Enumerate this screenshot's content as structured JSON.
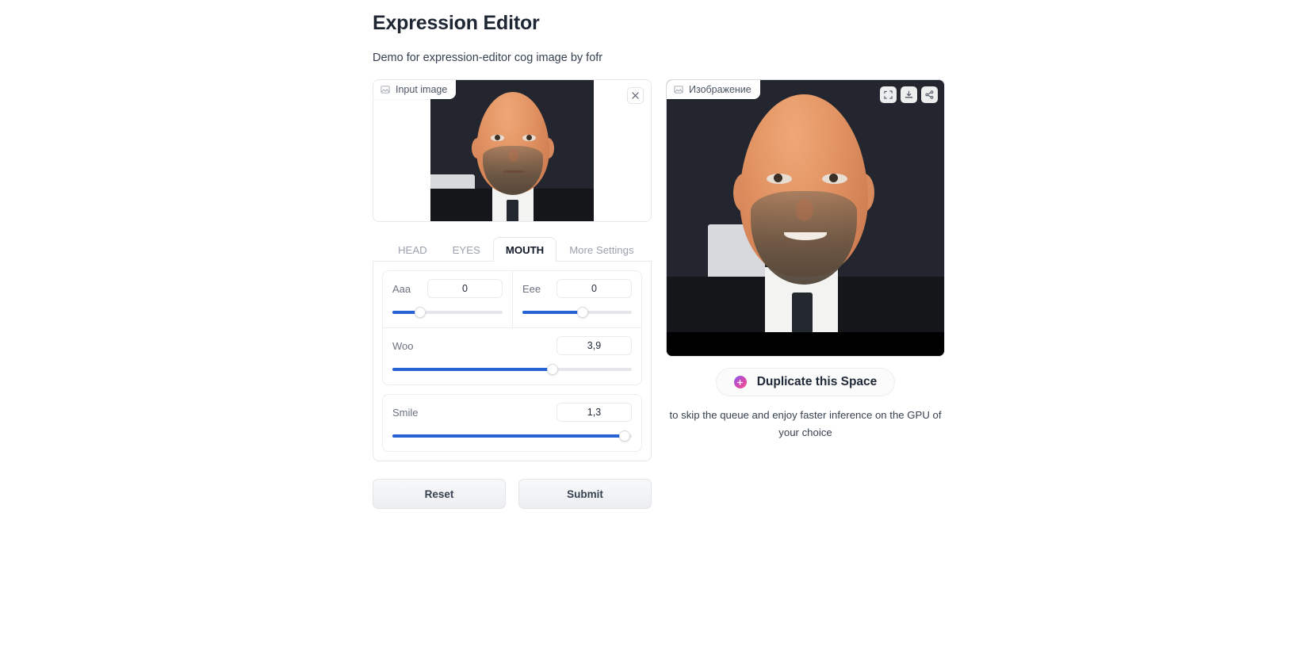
{
  "header": {
    "title": "Expression Editor",
    "subtitle": "Demo for expression-editor cog image by fofr"
  },
  "input_panel": {
    "label": "Input image",
    "label_icon": "image-icon",
    "close_icon": "close-icon"
  },
  "output_panel": {
    "label": "Изображение",
    "label_icon": "image-icon",
    "tools": [
      {
        "name": "fullscreen-icon"
      },
      {
        "name": "download-icon"
      },
      {
        "name": "share-icon"
      }
    ]
  },
  "tabs": [
    {
      "label": "HEAD",
      "active": false
    },
    {
      "label": "EYES",
      "active": false
    },
    {
      "label": "MOUTH",
      "active": true
    },
    {
      "label": "More Settings",
      "active": false
    }
  ],
  "sliders": {
    "aaa": {
      "label": "Aaa",
      "value": "0",
      "percent": 25
    },
    "eee": {
      "label": "Eee",
      "value": "0",
      "percent": 55
    },
    "woo": {
      "label": "Woo",
      "value": "3,9",
      "percent": 67
    },
    "smile": {
      "label": "Smile",
      "value": "1,3",
      "percent": 97
    }
  },
  "actions": {
    "reset": "Reset",
    "submit": "Submit"
  },
  "duplicate": {
    "button_label": "Duplicate this Space",
    "icon": "duplicate-plus-icon",
    "caption": "to skip the queue and enjoy faster inference on the GPU of your choice"
  },
  "colors": {
    "accent_blue": "#2563d4",
    "track_gray": "#e4e6e9",
    "border": "#e5e7eb",
    "text_primary": "#1f2937",
    "text_muted": "#6b7280"
  }
}
